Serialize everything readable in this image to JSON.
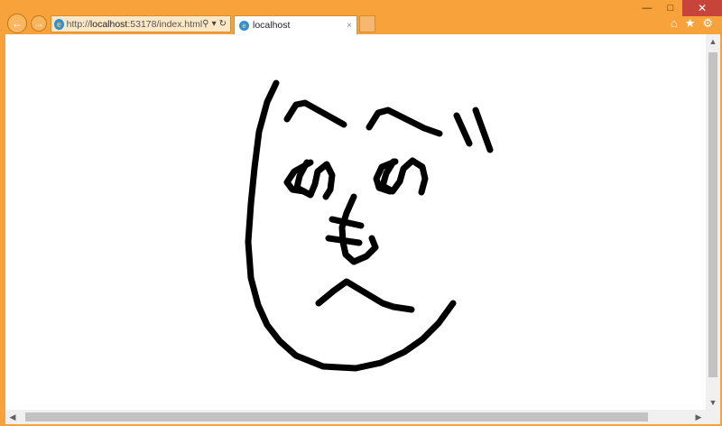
{
  "window": {
    "minimize_glyph": "—",
    "maximize_glyph": "□",
    "close_glyph": "✕"
  },
  "toolbar": {
    "back_glyph": "←",
    "forward_glyph": "→",
    "address": {
      "url_prefix": "http://",
      "url_host": "localhost",
      "url_suffix": ":53178/index.html",
      "search_glyph": "⚲",
      "dropdown_glyph": "▾",
      "refresh_glyph": "↻"
    },
    "tab": {
      "title": "localhost",
      "close_glyph": "×"
    },
    "icons": {
      "home": "⌂",
      "favorites": "★",
      "settings": "⚙"
    }
  },
  "content": {
    "drawing": "hand-drawn face doodle on white canvas",
    "stroke_color": "#000000",
    "background_color": "#ffffff"
  },
  "scrollbars": {
    "up_glyph": "▲",
    "down_glyph": "▼",
    "left_glyph": "◀",
    "right_glyph": "▶"
  },
  "colors": {
    "frame": "#f7a23a",
    "close_button": "#c7443a"
  }
}
